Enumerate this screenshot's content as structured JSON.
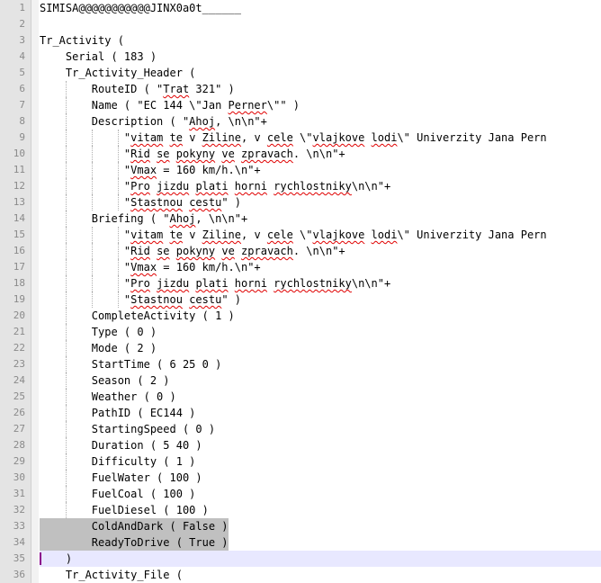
{
  "editor": {
    "line_numbers": [
      "1",
      "2",
      "3",
      "4",
      "5",
      "6",
      "7",
      "8",
      "9",
      "10",
      "11",
      "12",
      "13",
      "14",
      "15",
      "16",
      "17",
      "18",
      "19",
      "20",
      "21",
      "22",
      "23",
      "24",
      "25",
      "26",
      "27",
      "28",
      "29",
      "30",
      "31",
      "32",
      "33",
      "34",
      "35",
      "36"
    ],
    "lines": [
      "SIMISA@@@@@@@@@@@JINX0a0t______",
      "",
      "Tr_Activity (",
      "    Serial ( 183 )",
      "    Tr_Activity_Header (",
      "        RouteID ( \"Trat 321\" )",
      "        Name ( \"EC 144 \\\"Jan Perner\\\"\" )",
      "        Description ( \"Ahoj, \\n\\n\"+",
      "             \"vitam te v Ziline, v cele \\\"vlajkove lodi\\\" Univerzity Jana Pern",
      "             \"Rid se pokyny ve zpravach. \\n\\n\"+",
      "             \"Vmax = 160 km/h.\\n\"+",
      "             \"Pro jizdu plati horni rychlostniky\\n\\n\"+",
      "             \"Stastnou cestu\" )",
      "        Briefing ( \"Ahoj, \\n\\n\"+",
      "             \"vitam te v Ziline, v cele \\\"vlajkove lodi\\\" Univerzity Jana Pern",
      "             \"Rid se pokyny ve zpravach. \\n\\n\"+",
      "             \"Vmax = 160 km/h.\\n\"+",
      "             \"Pro jizdu plati horni rychlostniky\\n\\n\"+",
      "             \"Stastnou cestu\" )",
      "        CompleteActivity ( 1 )",
      "        Type ( 0 )",
      "        Mode ( 2 )",
      "        StartTime ( 6 25 0 )",
      "        Season ( 2 )",
      "        Weather ( 0 )",
      "        PathID ( EC144 )",
      "        StartingSpeed ( 0 )",
      "        Duration ( 5 40 )",
      "        Difficulty ( 1 )",
      "        FuelWater ( 100 )",
      "        FuelCoal ( 100 )",
      "        FuelDiesel ( 100 )",
      "        ColdAndDark ( False )",
      "        ReadyToDrive ( True )",
      "    )",
      "    Tr_Activity_File ("
    ],
    "selected_lines": [
      33,
      34
    ],
    "current_line": 35,
    "colors": {
      "gutter_bg": "#e4e4e4",
      "line_number": "#8a8a8a",
      "selection": "#c0c0c0",
      "current_line": "#e8e8ff",
      "caret": "#8b008b",
      "spellcheck": "#e00000"
    }
  }
}
